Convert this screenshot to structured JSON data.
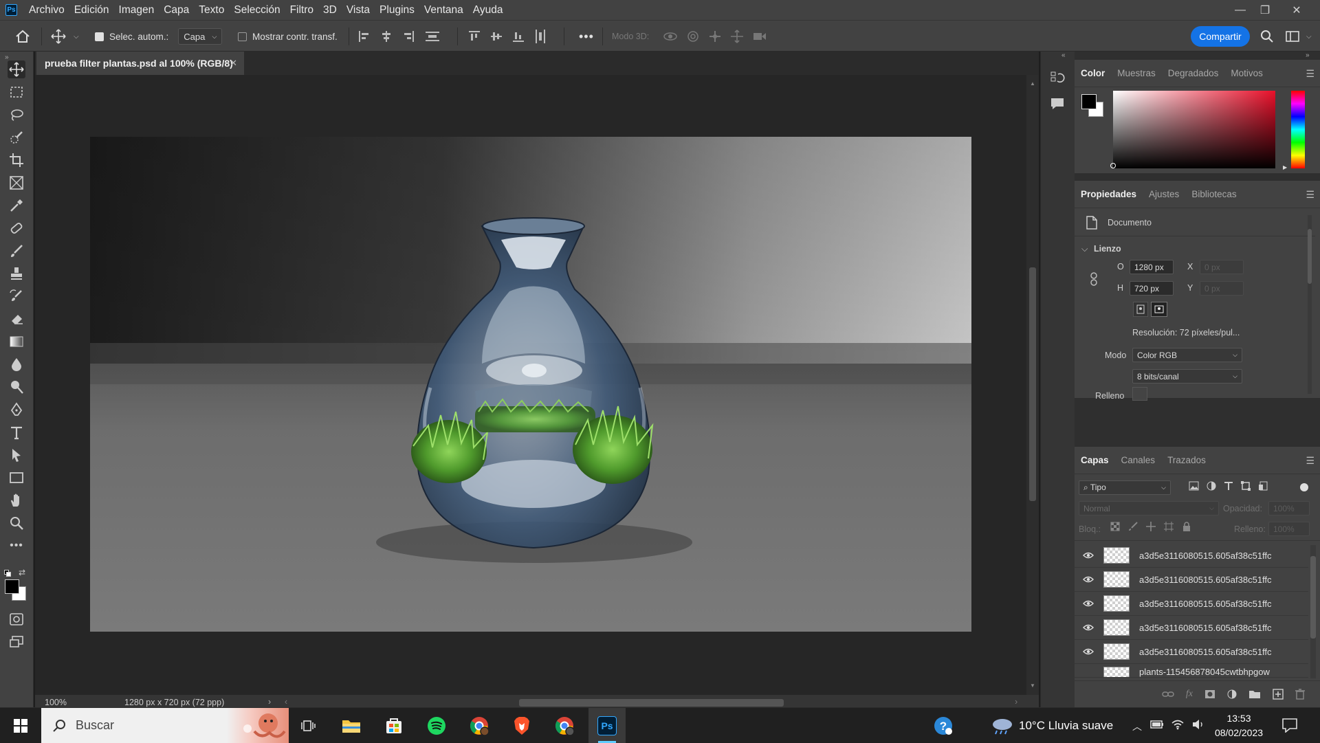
{
  "menubar": {
    "app_badge": "Ps",
    "items": [
      "Archivo",
      "Edición",
      "Imagen",
      "Capa",
      "Texto",
      "Selección",
      "Filtro",
      "3D",
      "Vista",
      "Plugins",
      "Ventana",
      "Ayuda"
    ]
  },
  "options": {
    "auto_select_label": "Selec. autom.:",
    "auto_select_target": "Capa",
    "show_transform_label": "Mostrar contr. transf.",
    "mode3d_label": "Modo 3D:",
    "share_label": "Compartir",
    "more": "•••"
  },
  "document": {
    "tab_title": "prueba filter plantas.psd al 100% (RGB/8)",
    "zoom": "100%",
    "info": "1280 px x 720 px (72 ppp)"
  },
  "color_panel": {
    "tabs": [
      "Color",
      "Muestras",
      "Degradados",
      "Motivos"
    ],
    "foreground": "#000000",
    "background": "#ffffff",
    "hue_color": "#e8102a"
  },
  "properties": {
    "tabs": [
      "Propiedades",
      "Ajustes",
      "Bibliotecas"
    ],
    "section_doc": "Documento",
    "section_canvas": "Lienzo",
    "w_label": "O",
    "w_value": "1280 px",
    "h_label": "H",
    "h_value": "720 px",
    "x_label": "X",
    "x_value": "0 px",
    "y_label": "Y",
    "y_value": "0 px",
    "resolution": "Resolución: 72 píxeles/pul...",
    "mode_label": "Modo",
    "mode_value": "Color RGB",
    "depth_value": "8 bits/canal",
    "fill_label": "Relleno"
  },
  "layers": {
    "tabs": [
      "Capas",
      "Canales",
      "Trazados"
    ],
    "filter_type": "Tipo",
    "blend_mode": "Normal",
    "opacity_label": "Opacidad:",
    "opacity_value": "100%",
    "lock_label": "Bloq.:",
    "fill_label": "Relleno:",
    "fill_value": "100%",
    "rows": [
      {
        "name": "a3d5e3116080515.605af38c51ffc"
      },
      {
        "name": "a3d5e3116080515.605af38c51ffc"
      },
      {
        "name": "a3d5e3116080515.605af38c51ffc"
      },
      {
        "name": "a3d5e3116080515.605af38c51ffc"
      },
      {
        "name": "a3d5e3116080515.605af38c51ffc"
      },
      {
        "name": "plants-115456878045cwtbhpgow"
      }
    ]
  },
  "taskbar": {
    "search_placeholder": "Buscar",
    "weather": "10°C  Lluvia suave",
    "time": "13:53",
    "date": "08/02/2023",
    "ps_badge": "Ps"
  }
}
